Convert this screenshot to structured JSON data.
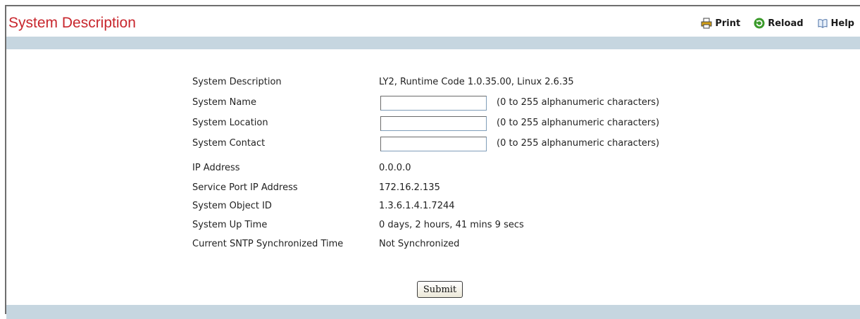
{
  "header": {
    "title": "System Description",
    "print_label": "Print",
    "reload_label": "Reload",
    "help_label": "Help"
  },
  "form": {
    "system_description": {
      "label": "System Description",
      "value": "LY2, Runtime Code 1.0.35.00, Linux 2.6.35"
    },
    "system_name": {
      "label": "System Name",
      "value": "",
      "hint": "(0 to 255 alphanumeric characters)"
    },
    "system_location": {
      "label": "System Location",
      "value": "",
      "hint": "(0 to 255 alphanumeric characters)"
    },
    "system_contact": {
      "label": "System Contact",
      "value": "",
      "hint": "(0 to 255 alphanumeric characters)"
    },
    "ip_address": {
      "label": "IP Address",
      "value": "0.0.0.0"
    },
    "service_port_ip": {
      "label": "Service Port IP Address",
      "value": "172.16.2.135"
    },
    "system_object_id": {
      "label": "System Object ID",
      "value": "1.3.6.1.4.1.7244"
    },
    "system_up_time": {
      "label": "System Up Time",
      "value": "0 days, 2 hours, 41 mins 9 secs"
    },
    "sntp_time": {
      "label": "Current SNTP Synchronized Time",
      "value": "Not Synchronized"
    },
    "submit_label": "Submit"
  },
  "colors": {
    "title": "#c8262d",
    "bar": "#c6d6e0",
    "reload_icon": "#3a9a2a",
    "print_icon": "#d4a017"
  },
  "icons": {
    "print": "printer-icon",
    "reload": "reload-icon",
    "help": "book-icon"
  }
}
